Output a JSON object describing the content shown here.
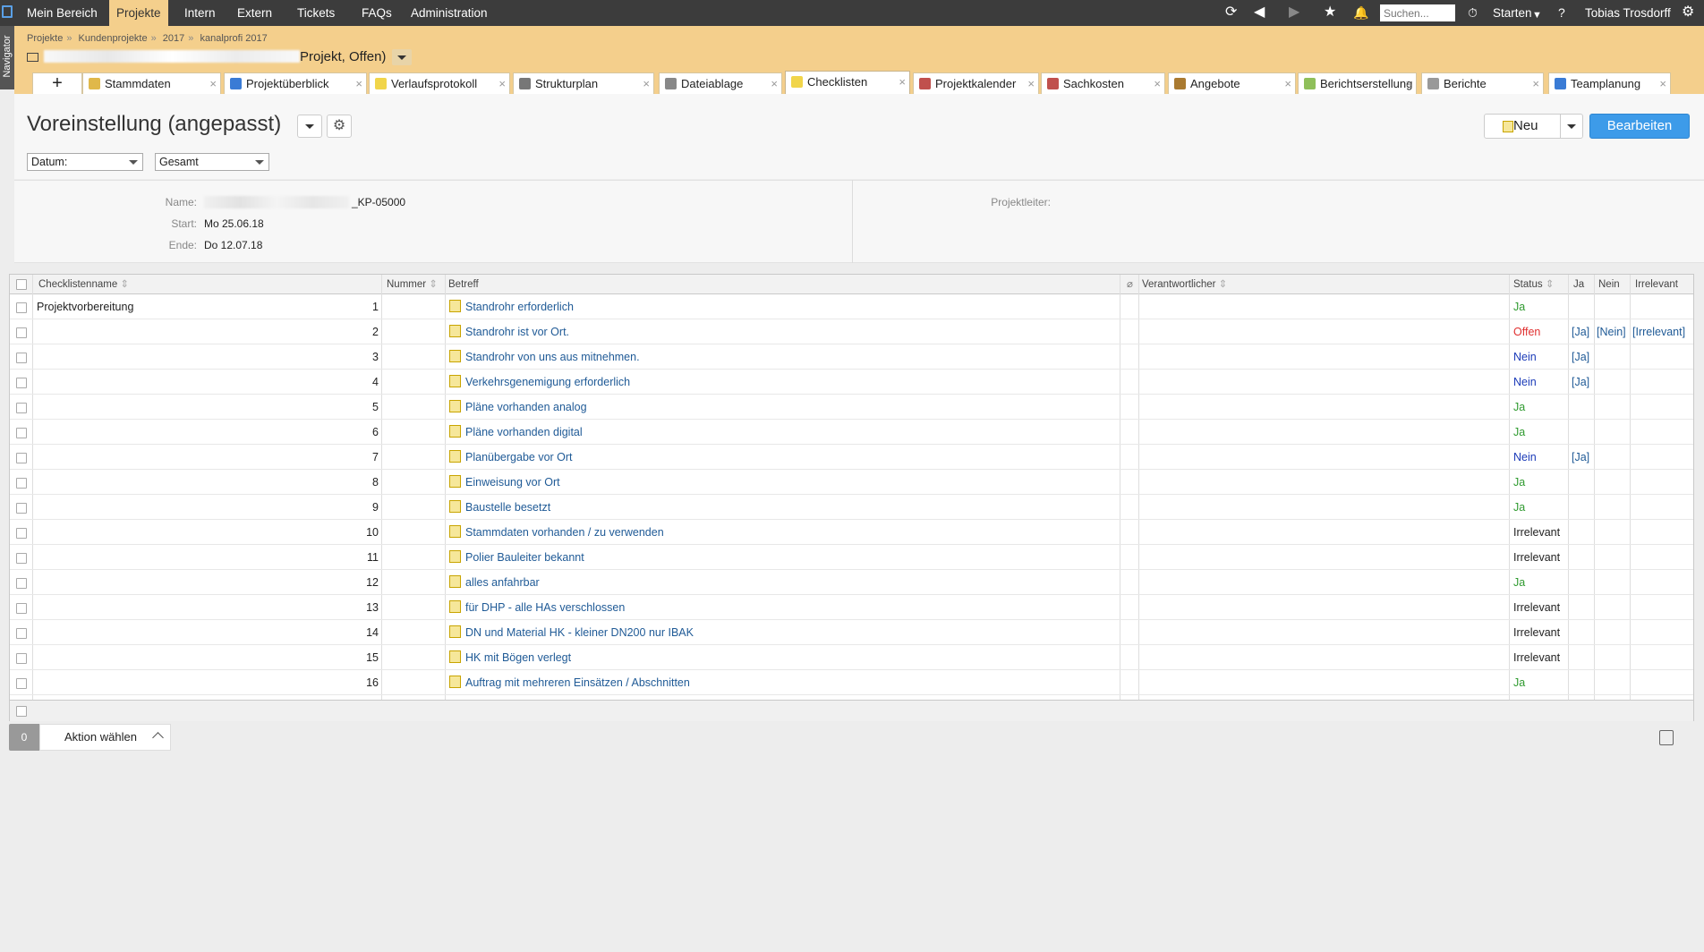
{
  "topnav": {
    "items": [
      "Mein Bereich",
      "Projekte",
      "Intern",
      "Extern",
      "Tickets",
      "FAQs",
      "Administration"
    ],
    "active": "Projekte",
    "search_placeholder": "Suchen...",
    "start_label": "Starten",
    "user": "Tobias Trosdorff"
  },
  "navigator_label": "Navigator",
  "breadcrumb": [
    "Projekte",
    "Kundenprojekte",
    "2017",
    "kanalprofi 2017"
  ],
  "project_title_suffix": "Projekt, Offen)",
  "tabs": [
    {
      "label": "Stammdaten",
      "icon": "folder-icon",
      "color": "#e0b84a"
    },
    {
      "label": "Projektüberblick",
      "icon": "info-icon",
      "color": "#3a7bd5"
    },
    {
      "label": "Verlaufsprotokoll",
      "icon": "note-icon",
      "color": "#f1d54a"
    },
    {
      "label": "Strukturplan",
      "icon": "structure-icon",
      "color": "#777777"
    },
    {
      "label": "Dateiablage",
      "icon": "paperclip-icon",
      "color": "#888888"
    },
    {
      "label": "Checklisten",
      "icon": "checklist-icon",
      "color": "#f1d54a"
    },
    {
      "label": "Projektkalender",
      "icon": "calendar-icon",
      "color": "#c0504d"
    },
    {
      "label": "Sachkosten",
      "icon": "costs-icon",
      "color": "#c0504d"
    },
    {
      "label": "Angebote",
      "icon": "offer-icon",
      "color": "#aa7a30"
    },
    {
      "label": "Berichtserstellung",
      "icon": "report-create-icon",
      "color": "#8fbf5a"
    },
    {
      "label": "Berichte",
      "icon": "report-icon",
      "color": "#999999"
    },
    {
      "label": "Teamplanung",
      "icon": "team-icon",
      "color": "#3a7bd5"
    }
  ],
  "active_tab": "Checklisten",
  "view": {
    "title": "Voreinstellung (angepasst)",
    "new_label": "Neu",
    "edit_label": "Bearbeiten"
  },
  "filters": {
    "date": "Datum:",
    "scope": "Gesamt"
  },
  "info": {
    "name_label": "Name:",
    "name_value": "_KP-05000",
    "start_label": "Start:",
    "start_value": "Mo 25.06.18",
    "end_label": "Ende:",
    "end_value": "Do 12.07.18",
    "leader_label": "Projektleiter:"
  },
  "table": {
    "headers": {
      "name": "Checklistenname",
      "number": "Nummer",
      "subject": "Betreff",
      "responsible": "Verantwortlicher",
      "status": "Status",
      "yes": "Ja",
      "no": "Nein",
      "irrelevant": "Irrelevant"
    },
    "group": "Projektvorbereitung",
    "rows": [
      {
        "n": "1",
        "s": "Standrohr erforderlich",
        "st": "Ja",
        "a": [
          "",
          "",
          ""
        ]
      },
      {
        "n": "2",
        "s": "Standrohr ist vor Ort.",
        "st": "Offen",
        "a": [
          "[Ja]",
          "[Nein]",
          "[Irrelevant]"
        ]
      },
      {
        "n": "3",
        "s": "Standrohr von uns aus mitnehmen.",
        "st": "Nein",
        "a": [
          "[Ja]",
          "",
          ""
        ]
      },
      {
        "n": "4",
        "s": "Verkehrsgenemigung erforderlich",
        "st": "Nein",
        "a": [
          "[Ja]",
          "",
          ""
        ]
      },
      {
        "n": "5",
        "s": "Pläne vorhanden analog",
        "st": "Ja",
        "a": [
          "",
          "",
          ""
        ]
      },
      {
        "n": "6",
        "s": "Pläne vorhanden digital",
        "st": "Ja",
        "a": [
          "",
          "",
          ""
        ]
      },
      {
        "n": "7",
        "s": "Planübergabe vor Ort",
        "st": "Nein",
        "a": [
          "[Ja]",
          "",
          ""
        ]
      },
      {
        "n": "8",
        "s": "Einweisung vor Ort",
        "st": "Ja",
        "a": [
          "",
          "",
          ""
        ]
      },
      {
        "n": "9",
        "s": "Baustelle besetzt",
        "st": "Ja",
        "a": [
          "",
          "",
          ""
        ]
      },
      {
        "n": "10",
        "s": "Stammdaten vorhanden / zu verwenden",
        "st": "Irrelevant",
        "a": [
          "",
          "",
          ""
        ]
      },
      {
        "n": "11",
        "s": "Polier Bauleiter bekannt",
        "st": "Irrelevant",
        "a": [
          "",
          "",
          ""
        ]
      },
      {
        "n": "12",
        "s": "alles anfahrbar",
        "st": "Ja",
        "a": [
          "",
          "",
          ""
        ]
      },
      {
        "n": "13",
        "s": "für DHP - alle HAs verschlossen",
        "st": "Irrelevant",
        "a": [
          "",
          "",
          ""
        ]
      },
      {
        "n": "14",
        "s": "DN und Material HK - kleiner DN200 nur IBAK",
        "st": "Irrelevant",
        "a": [
          "",
          "",
          ""
        ]
      },
      {
        "n": "15",
        "s": "HK mit Bögen verlegt",
        "st": "Irrelevant",
        "a": [
          "",
          "",
          ""
        ]
      },
      {
        "n": "16",
        "s": "Auftrag mit mehreren Einsätzen / Abschnitten",
        "st": "Ja",
        "a": [
          "",
          "",
          ""
        ]
      }
    ]
  },
  "actions": {
    "count": "0",
    "label": "Aktion wählen"
  },
  "colors": {
    "topbar": "#3c3c3c",
    "accent": "#f4cf8c",
    "primary_button": "#3d9be9",
    "status_ja": "#2f9a2f",
    "status_nein": "#1b3bb8",
    "status_offen": "#e03030"
  }
}
